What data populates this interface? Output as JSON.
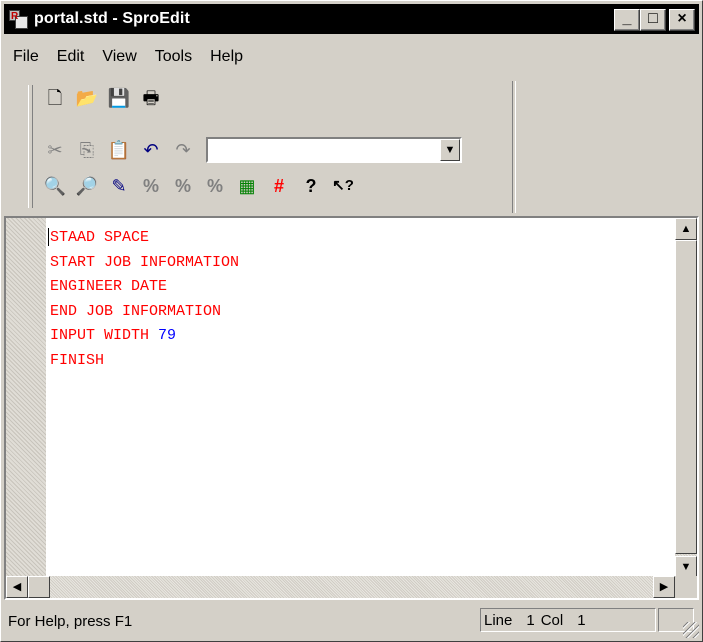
{
  "window": {
    "title": "portal.std - SproEdit",
    "app_icon": "sproedit-app-icon",
    "controls": {
      "minimize": "_",
      "maximize": "□",
      "close": "×"
    }
  },
  "menu": [
    {
      "label": "File"
    },
    {
      "label": "Edit"
    },
    {
      "label": "View"
    },
    {
      "label": "Tools"
    },
    {
      "label": "Help"
    }
  ],
  "toolbar": {
    "row1": [
      {
        "icon": "new-file-icon",
        "glyph": "🗋"
      },
      {
        "icon": "open-folder-icon",
        "glyph": "📂"
      },
      {
        "icon": "save-icon",
        "glyph": "💾"
      },
      {
        "icon": "print-icon",
        "glyph": "🖶"
      }
    ],
    "row2": [
      {
        "icon": "cut-icon",
        "glyph": "✂"
      },
      {
        "icon": "copy-icon",
        "glyph": "⎘"
      },
      {
        "icon": "paste-icon",
        "glyph": "📋"
      },
      {
        "icon": "undo-icon",
        "glyph": "↶"
      },
      {
        "icon": "redo-icon",
        "glyph": "↷"
      }
    ],
    "combo_value": "",
    "row3": [
      {
        "icon": "find-icon",
        "glyph": "🔍"
      },
      {
        "icon": "find-next-icon",
        "glyph": "🔎"
      },
      {
        "icon": "pen-icon",
        "glyph": "✎"
      },
      {
        "icon": "percent-icon",
        "glyph": "%"
      },
      {
        "icon": "percent-alt-icon",
        "glyph": "%"
      },
      {
        "icon": "percent-tool-icon",
        "glyph": "%"
      },
      {
        "icon": "calculator-icon",
        "glyph": "▦"
      },
      {
        "icon": "grid-swap-icon",
        "glyph": "#"
      },
      {
        "icon": "help-icon",
        "glyph": "?"
      },
      {
        "icon": "context-help-icon",
        "glyph": "↖?"
      }
    ]
  },
  "editor": {
    "lines": [
      [
        {
          "text": "STAAD SPACE",
          "type": "keyword"
        }
      ],
      [
        {
          "text": "START JOB INFORMATION",
          "type": "keyword"
        }
      ],
      [
        {
          "text": "ENGINEER DATE",
          "type": "keyword"
        }
      ],
      [
        {
          "text": "END JOB INFORMATION",
          "type": "keyword"
        }
      ],
      [
        {
          "text": "INPUT WIDTH ",
          "type": "keyword"
        },
        {
          "text": "79",
          "type": "number"
        }
      ],
      [
        {
          "text": "FINISH",
          "type": "keyword"
        }
      ]
    ],
    "keyword_color": "#ff0000",
    "number_color": "#0000ff"
  },
  "status": {
    "help_text": "For Help, press F1",
    "line_label": "Line",
    "line_value": "1",
    "col_label": "Col",
    "col_value": "1"
  }
}
